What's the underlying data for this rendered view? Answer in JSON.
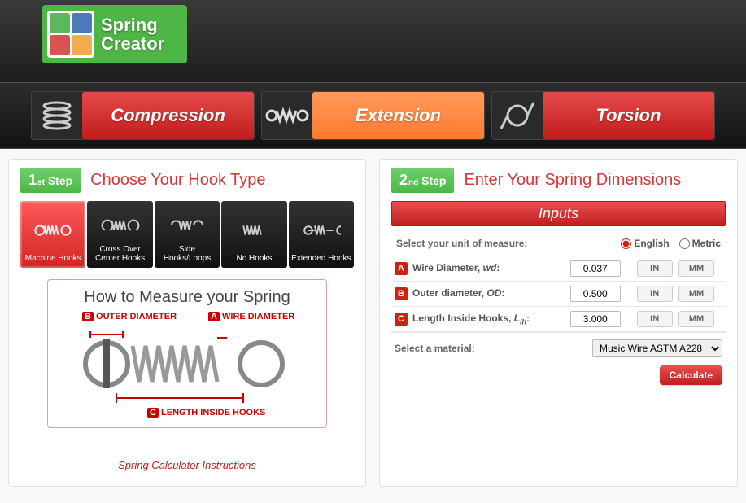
{
  "app": {
    "title_line1": "Spring",
    "title_line2": "Creator"
  },
  "nav": {
    "compression": "Compression",
    "extension": "Extension",
    "torsion": "Torsion",
    "active": "extension"
  },
  "step1": {
    "badge_num": "1",
    "badge_suffix": "st",
    "badge_word": "Step",
    "title": "Choose Your Hook Type",
    "hooks": [
      {
        "id": "machine",
        "label": "Machine Hooks",
        "selected": true
      },
      {
        "id": "crossover",
        "label": "Cross Over Center Hooks",
        "selected": false
      },
      {
        "id": "side",
        "label": "Side Hooks/Loops",
        "selected": false
      },
      {
        "id": "none",
        "label": "No Hooks",
        "selected": false
      },
      {
        "id": "extended",
        "label": "Extended Hooks",
        "selected": false
      }
    ],
    "measure_title": "How to Measure your Spring",
    "diag_b": "B OUTER DIAMETER",
    "diag_a": "A WIRE DIAMETER",
    "diag_c": "C LENGTH INSIDE HOOKS",
    "instructions_link": "Spring Calculator Instructions"
  },
  "step2": {
    "badge_num": "2",
    "badge_suffix": "nd",
    "badge_word": "Step",
    "title": "Enter Your Spring Dimensions",
    "inputs_header": "Inputs",
    "unit_label": "Select your unit of measure:",
    "unit_english": "English",
    "unit_metric": "Metric",
    "unit_selected": "English",
    "rows": [
      {
        "tag": "A",
        "label": "Wire Diameter, wd:",
        "value": "0.037",
        "u1": "IN",
        "u2": "MM"
      },
      {
        "tag": "B",
        "label": "Outer diameter, OD:",
        "value": "0.500",
        "u1": "IN",
        "u2": "MM"
      },
      {
        "tag": "C",
        "label": "Length Inside Hooks, Lih:",
        "value": "3.000",
        "u1": "IN",
        "u2": "MM"
      }
    ],
    "material_label": "Select a material:",
    "material_selected": "Music Wire ASTM A228",
    "material_options": [
      "Music Wire ASTM A228"
    ],
    "calculate": "Calculate"
  }
}
